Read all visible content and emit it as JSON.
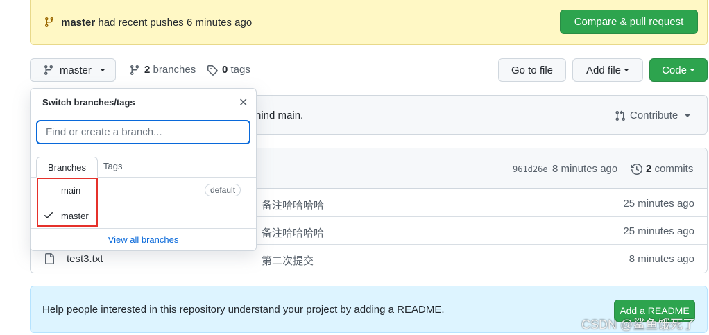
{
  "banner": {
    "branch": "master",
    "text": "had recent pushes 6 minutes ago",
    "compare_label": "Compare & pull request"
  },
  "toolbar": {
    "branch_label": "master",
    "branches_count": "2",
    "branches_label": "branches",
    "tags_count": "0",
    "tags_label": "tags",
    "goto_label": "Go to file",
    "addfile_label": "Add file",
    "code_label": "Code"
  },
  "status": {
    "behind_text": "hind main.",
    "contribute_label": "Contribute"
  },
  "latest_commit": {
    "sha": "961d26e",
    "ago": "8 minutes ago",
    "commits_count": "2",
    "commits_label": "commits"
  },
  "files": [
    {
      "name": "",
      "message": "备注哈哈哈哈",
      "ago": "25 minutes ago"
    },
    {
      "name": "",
      "message": "备注哈哈哈哈",
      "ago": "25 minutes ago"
    },
    {
      "name": "test3.txt",
      "message": "第二次提交",
      "ago": "8 minutes ago"
    }
  ],
  "readme": {
    "text": "Help people interested in this repository understand your project by adding a README.",
    "button_label": "Add a README"
  },
  "dropdown": {
    "title": "Switch branches/tags",
    "search_placeholder": "Find or create a branch...",
    "tab_branches": "Branches",
    "tab_tags": "Tags",
    "branches": [
      {
        "name": "main",
        "badge": "default",
        "selected": false
      },
      {
        "name": "master",
        "badge": "",
        "selected": true
      }
    ],
    "view_all": "View all branches"
  },
  "watermark": "CSDN @鲨鱼饿死了",
  "colors": {
    "accent_green": "#2da44e",
    "link_blue": "#0969da",
    "banner_yellow": "#fff8c5",
    "highlight_red": "#e5312b"
  }
}
